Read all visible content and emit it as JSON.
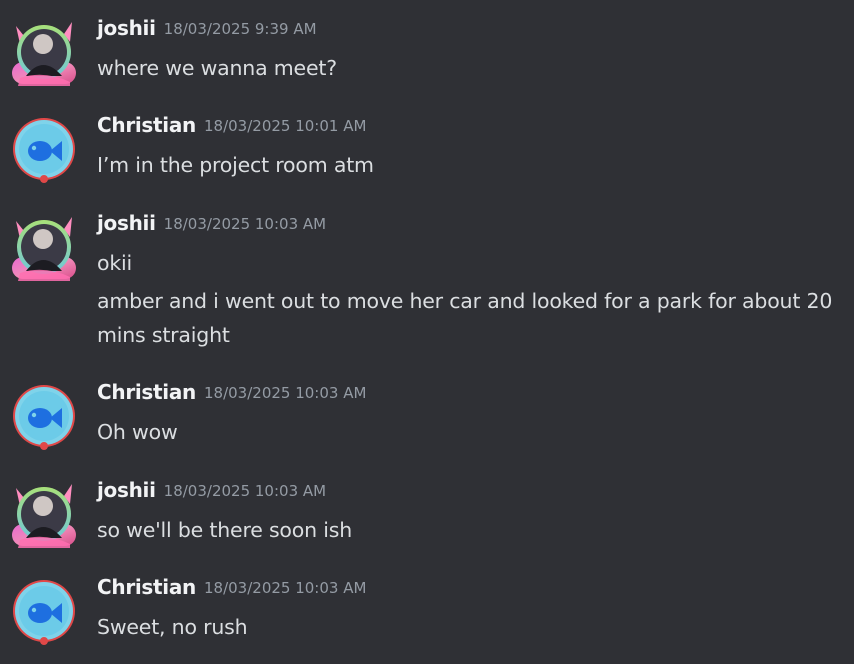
{
  "colors": {
    "background": "#2f3035",
    "author": "#f2f3f5",
    "timestamp": "#949ba4",
    "text": "#dbdee1"
  },
  "messages": [
    {
      "author": "joshii",
      "avatar": "joshii-avatar",
      "timestamp": "18/03/2025 9:39 AM",
      "lines": [
        "where we wanna meet?"
      ]
    },
    {
      "author": "Christian",
      "avatar": "fish-avatar",
      "timestamp": "18/03/2025 10:01 AM",
      "lines": [
        "I’m in the project room atm"
      ]
    },
    {
      "author": "joshii",
      "avatar": "joshii-avatar",
      "timestamp": "18/03/2025 10:03 AM",
      "lines": [
        "okii",
        "amber and i went out to move her car and looked for a park for about 20",
        "mins straight"
      ]
    },
    {
      "author": "Christian",
      "avatar": "fish-avatar",
      "timestamp": "18/03/2025 10:03 AM",
      "lines": [
        "Oh wow"
      ]
    },
    {
      "author": "joshii",
      "avatar": "joshii-avatar",
      "timestamp": "18/03/2025 10:03 AM",
      "lines": [
        "so we'll be there soon ish"
      ]
    },
    {
      "author": "Christian",
      "avatar": "fish-avatar",
      "timestamp": "18/03/2025 10:03 AM",
      "lines": [
        "Sweet, no rush"
      ]
    }
  ]
}
